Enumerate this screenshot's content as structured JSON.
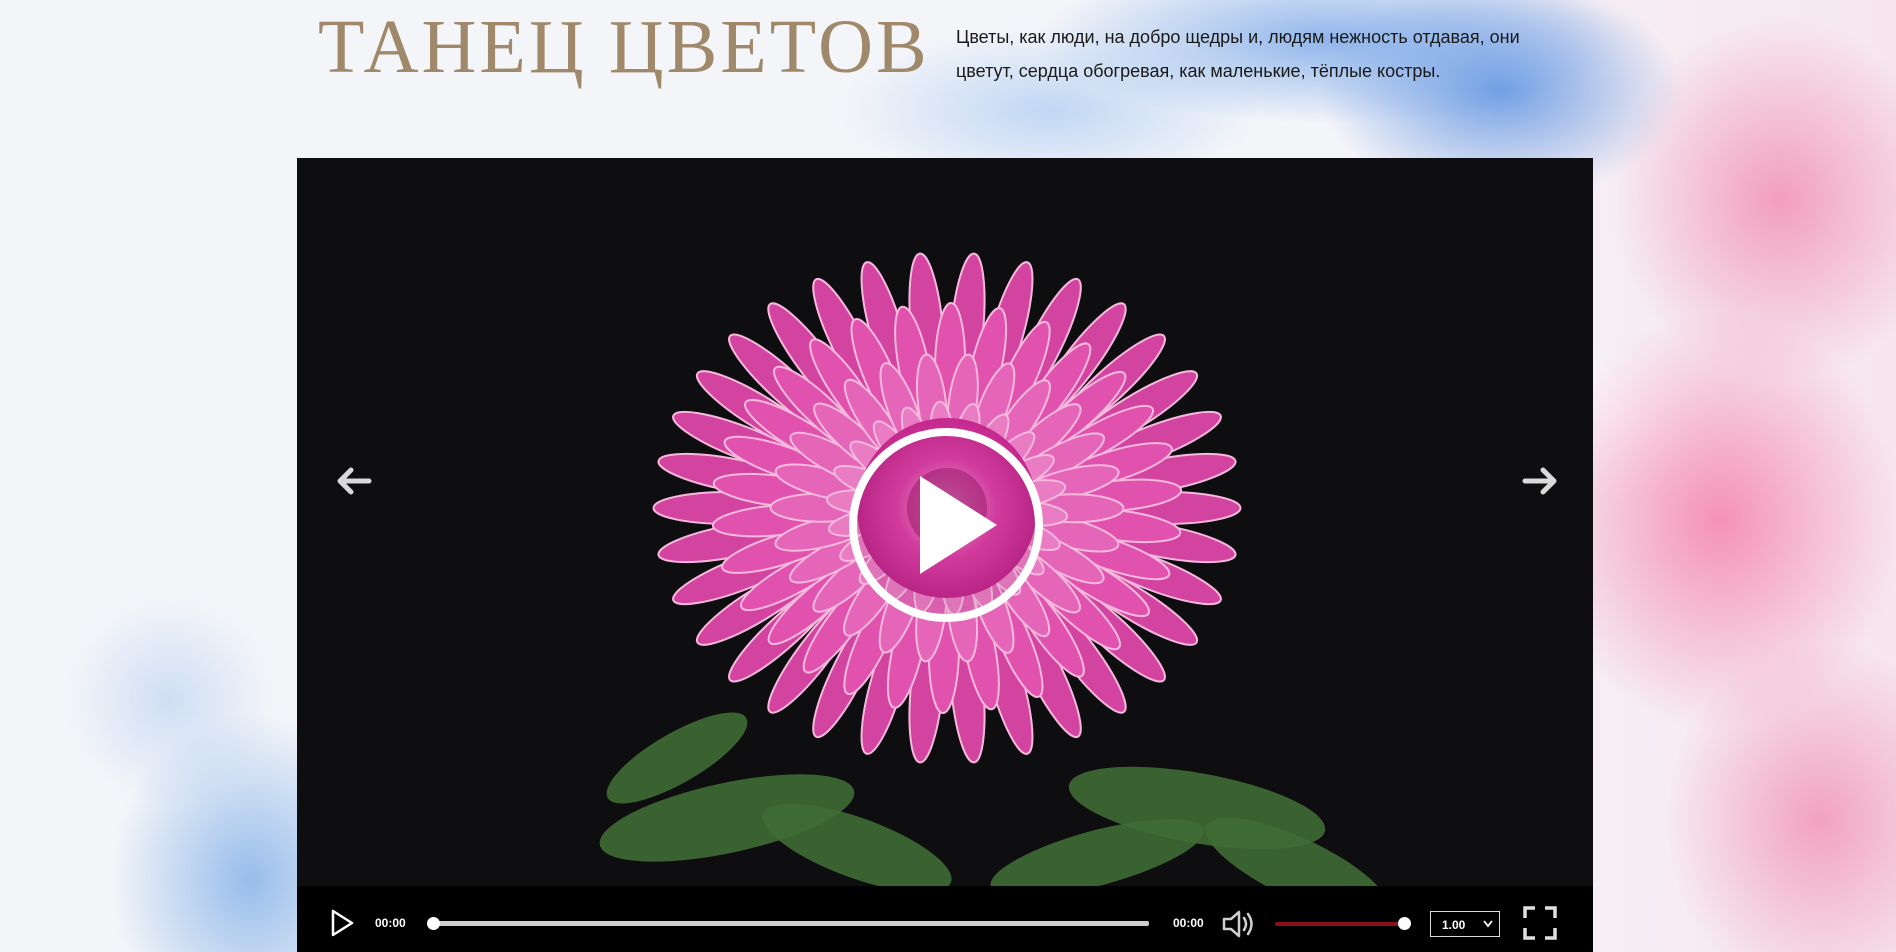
{
  "header": {
    "title": "ТАНЕЦ ЦВЕТОВ",
    "subtitle": "Цветы, как люди, на добро щедры и, людям нежность отдавая, они цветут, сердца обогревая, как маленькие, тёплые костры."
  },
  "player": {
    "video_subject": "pink-chrysanthemum",
    "nav": {
      "prev_icon": "arrow-left-icon",
      "next_icon": "arrow-right-icon"
    },
    "big_play_icon": "play-circle-icon",
    "controls": {
      "play_icon": "play-icon",
      "current_time": "00:00",
      "total_time": "00:00",
      "progress_fraction": 0,
      "volume_icon": "volume-icon",
      "volume_fraction": 1,
      "speed": "1.00",
      "fullscreen_icon": "fullscreen-icon"
    }
  },
  "colors": {
    "title": "#a0896a",
    "volume_bar": "#8b0f16",
    "petal": "#e040a8"
  }
}
